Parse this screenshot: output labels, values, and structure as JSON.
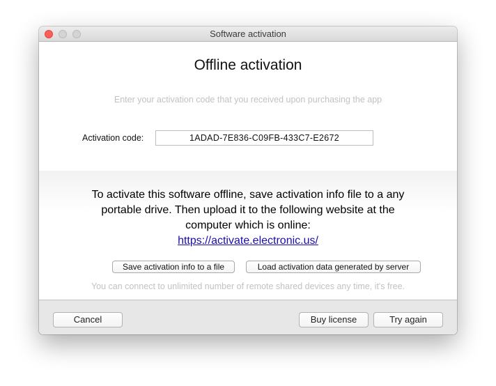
{
  "window": {
    "title": "Software activation"
  },
  "main": {
    "heading": "Offline activation",
    "hint": "Enter your activation code that you received upon purchasing the app",
    "activation_code_label": "Activation code:",
    "activation_code_value": "1ADAD-7E836-C09FB-433C7-E2672",
    "instructions_line1": "To activate this software offline, save activation info file to a any",
    "instructions_line2": "portable drive. Then upload it to the following website at the",
    "instructions_line3": "computer which is online:",
    "activation_link": "https://activate.electronic.us/",
    "save_button": "Save activation info to a file",
    "load_button": "Load activation data generated by server",
    "footnote": "You can connect to unlimited number of remote shared devices any time, it's free."
  },
  "footer": {
    "cancel": "Cancel",
    "buy_license": "Buy license",
    "try_again": "Try again"
  },
  "colors": {
    "close_button": "#fc5f57",
    "link": "#1a0dab",
    "hint_text": "#c2c2c2",
    "footer_bg": "#e7e7e7"
  }
}
